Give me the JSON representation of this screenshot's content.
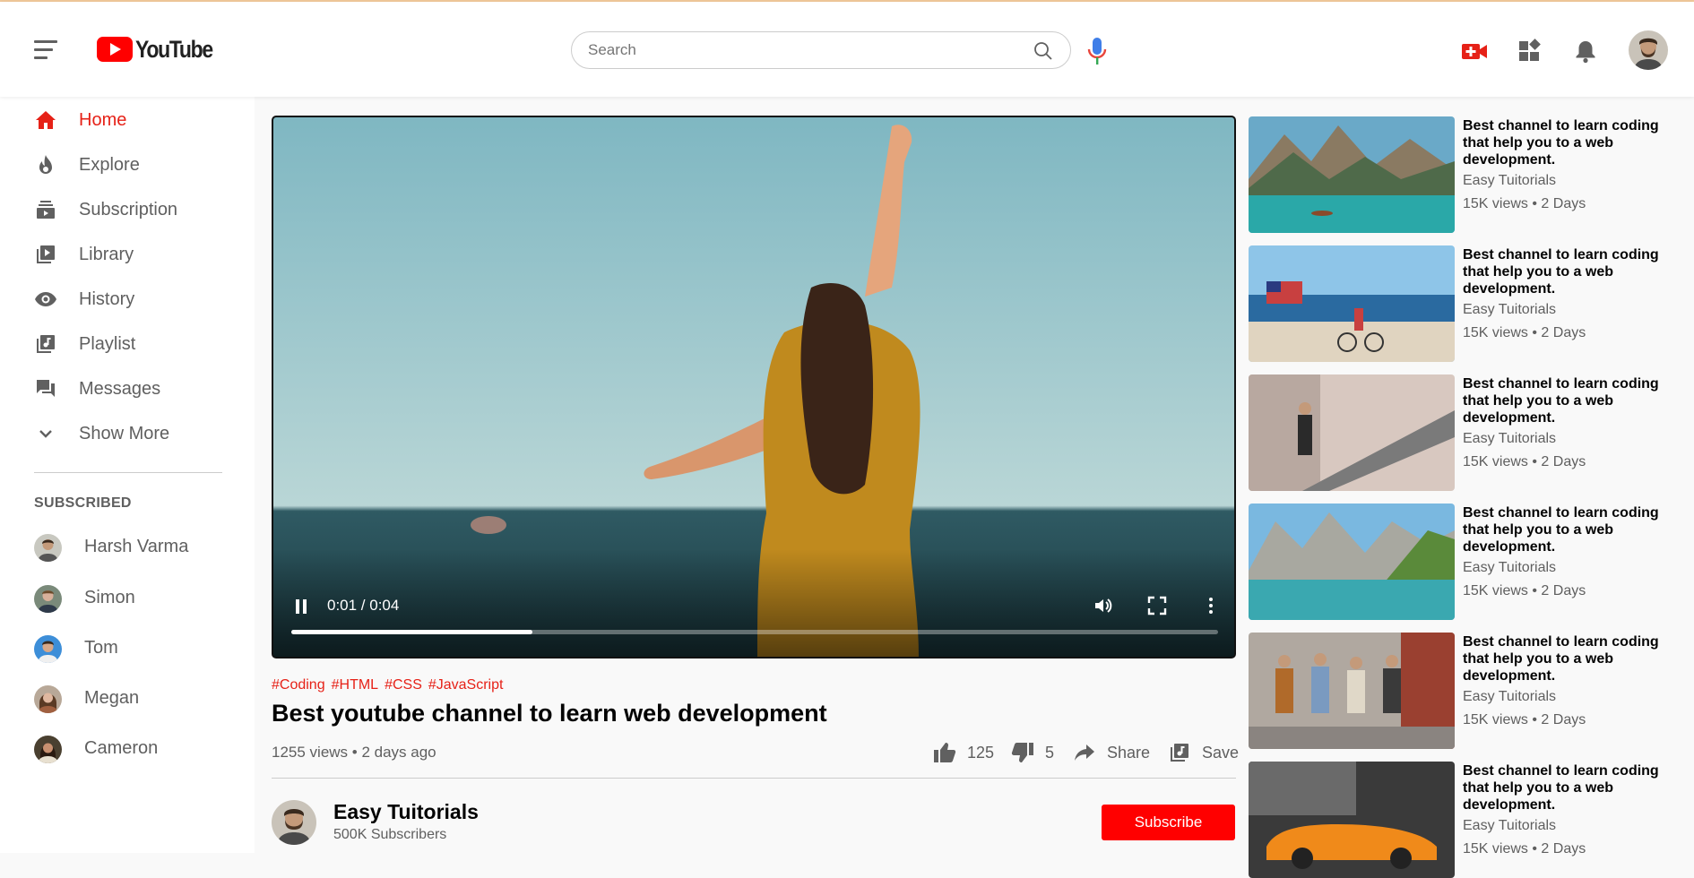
{
  "header": {
    "logo_text": "YouTube",
    "search_placeholder": "Search"
  },
  "sidebar": {
    "items": [
      {
        "label": "Home",
        "icon": "home-icon",
        "active": true
      },
      {
        "label": "Explore",
        "icon": "fire-icon"
      },
      {
        "label": "Subscription",
        "icon": "subscriptions-icon"
      },
      {
        "label": "Library",
        "icon": "library-icon"
      },
      {
        "label": "History",
        "icon": "eye-icon"
      },
      {
        "label": "Playlist",
        "icon": "playlist-icon"
      },
      {
        "label": "Messages",
        "icon": "chat-icon"
      },
      {
        "label": "Show More",
        "icon": "chevron-down-icon"
      }
    ],
    "subscribed_title": "SUBSCRIBED",
    "subscriptions": [
      "Harsh Varma",
      "Simon",
      "Tom",
      "Megan",
      "Cameron"
    ]
  },
  "player": {
    "time": "0:01 / 0:04",
    "progress": 0.26
  },
  "video": {
    "tags": [
      "#Coding",
      "#HTML",
      "#CSS",
      "#JavaScript"
    ],
    "title": "Best youtube channel to learn web development",
    "meta": "1255 views • 2 days ago",
    "likes": "125",
    "dislikes": "5",
    "share_label": "Share",
    "save_label": "Save"
  },
  "channel": {
    "name": "Easy Tuitorials",
    "subscribers": "500K Subscribers",
    "subscribe_label": "Subscribe"
  },
  "recommendations": [
    {
      "title": "Best channel to learn coding that help you to a web development.",
      "channel": "Easy Tuitorials",
      "meta": "15K views • 2 Days",
      "thumb": "lake-boat"
    },
    {
      "title": "Best channel to learn coding that help you to a web development.",
      "channel": "Easy Tuitorials",
      "meta": "15K views • 2 Days",
      "thumb": "beach-flag"
    },
    {
      "title": "Best channel to learn coding that help you to a web development.",
      "channel": "Easy Tuitorials",
      "meta": "15K views • 2 Days",
      "thumb": "escalator"
    },
    {
      "title": "Best channel to learn coding that help you to a web development.",
      "channel": "Easy Tuitorials",
      "meta": "15K views • 2 Days",
      "thumb": "mountain-lake"
    },
    {
      "title": "Best channel to learn coding that help you to a web development.",
      "channel": "Easy Tuitorials",
      "meta": "15K views • 2 Days",
      "thumb": "friends-street"
    },
    {
      "title": "Best channel to learn coding that help you to a web development.",
      "channel": "Easy Tuitorials",
      "meta": "15K views • 2 Days",
      "thumb": "orange-car"
    }
  ],
  "colors": {
    "accent": "#e62117",
    "subscribe": "#ff0000",
    "text_secondary": "#5f5f5f"
  }
}
